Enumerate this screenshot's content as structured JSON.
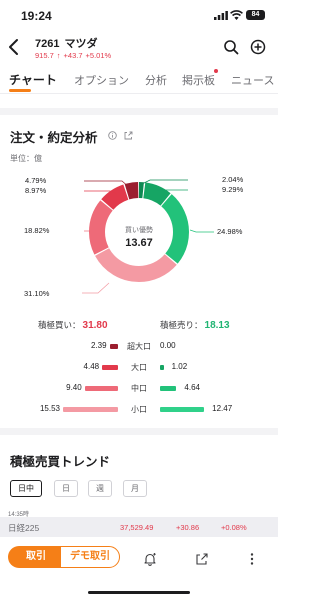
{
  "status_bar": {
    "time": "19:24",
    "battery": "84"
  },
  "header": {
    "code": "7261",
    "name": "マツダ",
    "price": "915.7",
    "change": "+43.7",
    "change_pct": "+5.01%"
  },
  "tabs": [
    "チャート",
    "オプション",
    "分析",
    "掲示板",
    "ニュース"
  ],
  "order_analysis": {
    "title": "注文・約定分析",
    "unit": "単位：億",
    "center_label": "買い優勢",
    "center_value": "13.67",
    "buy_total_label": "積極買い：",
    "buy_total_value": "31.80",
    "sell_total_label": "積極売り：",
    "sell_total_value": "18.13",
    "colors": {
      "buy_xl": "#9b1e2f",
      "buy_l": "#e2394b",
      "buy_m": "#ee6a78",
      "buy_s": "#f49aa3",
      "sell_xl": "#0d8a52",
      "sell_l": "#16a564",
      "sell_m": "#22c27a",
      "sell_s": "#30d18a"
    },
    "segments": [
      {
        "name": "sell-xl",
        "pct": "2.04%",
        "value": 2.04
      },
      {
        "name": "sell-l",
        "pct": "9.29%",
        "value": 9.29
      },
      {
        "name": "sell-m",
        "pct": "24.98%",
        "value": 24.98
      },
      {
        "name": "buy-s",
        "pct": "31.10%",
        "value": 31.1
      },
      {
        "name": "buy-m",
        "pct": "18.82%",
        "value": 18.82
      },
      {
        "name": "buy-l",
        "pct": "8.97%",
        "value": 8.97
      },
      {
        "name": "buy-xl",
        "pct": "4.79%",
        "value": 4.79
      }
    ],
    "rows": [
      {
        "label": "超大口",
        "buy": "2.39",
        "sell": "0.00",
        "buy_value": 2.39,
        "sell_value": 0.0
      },
      {
        "label": "大口",
        "buy": "4.48",
        "sell": "1.02",
        "buy_value": 4.48,
        "sell_value": 1.02
      },
      {
        "label": "中口",
        "buy": "9.40",
        "sell": "4.64",
        "buy_value": 9.4,
        "sell_value": 4.64
      },
      {
        "label": "小口",
        "buy": "15.53",
        "sell": "12.47",
        "buy_value": 15.53,
        "sell_value": 12.47
      }
    ]
  },
  "trend": {
    "title": "積極売買トレンド",
    "chips": [
      "日中",
      "日",
      "週",
      "月"
    ],
    "active_chip": "日中",
    "time": "14:35時"
  },
  "index_bar": {
    "name": "日経225",
    "value": "37,529.49",
    "change": "+30.86",
    "change_pct": "+0.08%"
  },
  "bottom_bar": {
    "trade_label": "取引",
    "demo_label": "デモ取引"
  }
}
